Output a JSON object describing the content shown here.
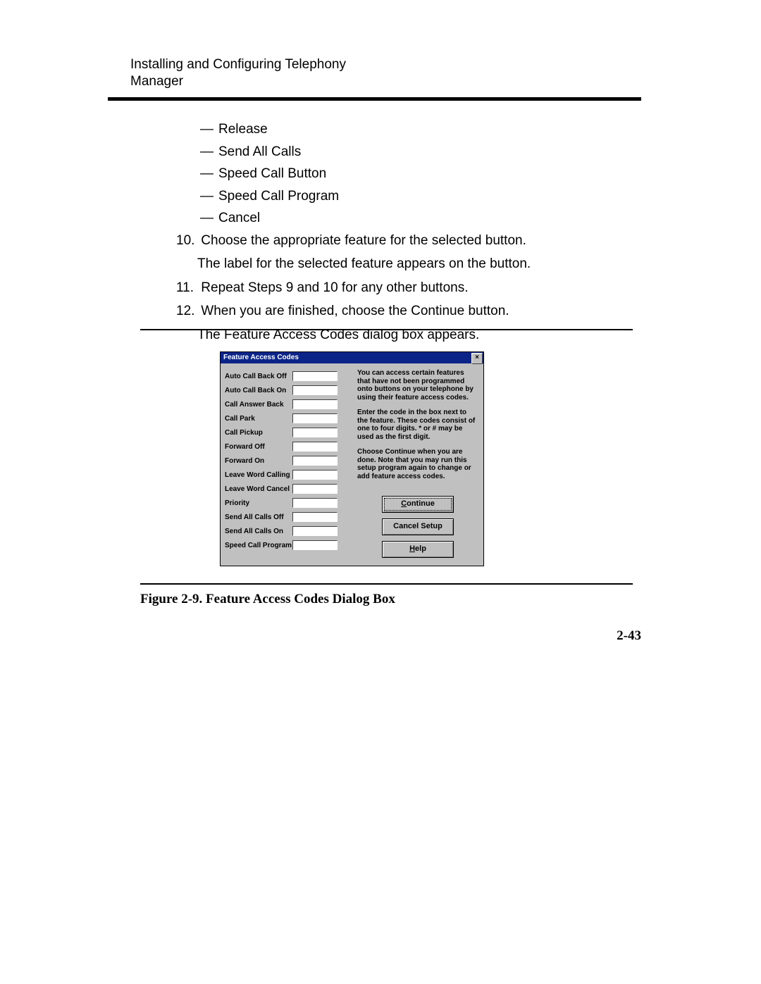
{
  "header": {
    "running_title": "Installing and Configuring Telephony Manager"
  },
  "dash_items": [
    "Release",
    "Send All Calls",
    "Speed Call Button",
    "Speed Call Program",
    "Cancel"
  ],
  "steps": [
    {
      "n": "10.",
      "text": "Choose the appropriate feature for the selected button.",
      "cont": "The label for the selected feature appears on the button."
    },
    {
      "n": "11.",
      "text": "Repeat Steps 9 and 10 for any other buttons."
    },
    {
      "n": "12.",
      "text": "When you are finished, choose the Continue button.",
      "cont": "The Feature Access Codes dialog box appears."
    }
  ],
  "figure": {
    "caption": "Figure 2-9.  Feature Access Codes Dialog Box"
  },
  "page_number": "2-43",
  "dialog": {
    "title": "Feature Access Codes",
    "features": [
      "Auto Call Back Off",
      "Auto Call Back On",
      "Call Answer Back",
      "Call Park",
      "Call Pickup",
      "Forward Off",
      "Forward On",
      "Leave Word Calling",
      "Leave Word Cancel",
      "Priority",
      "Send All Calls Off",
      "Send All Calls On",
      "Speed Call Program"
    ],
    "info": {
      "p1": "You can access certain features that have not been programmed onto buttons on your telephone by using their feature access codes.",
      "p2": "Enter the code in the box next to the feature.  These codes consist of one to four digits.  * or # may be used as the first digit.",
      "p3": "Choose Continue when you are done. Note that you may run this setup program again to change or add feature access codes."
    },
    "buttons": {
      "continue": "Continue",
      "cancel": "Cancel Setup",
      "help": "Help"
    }
  }
}
